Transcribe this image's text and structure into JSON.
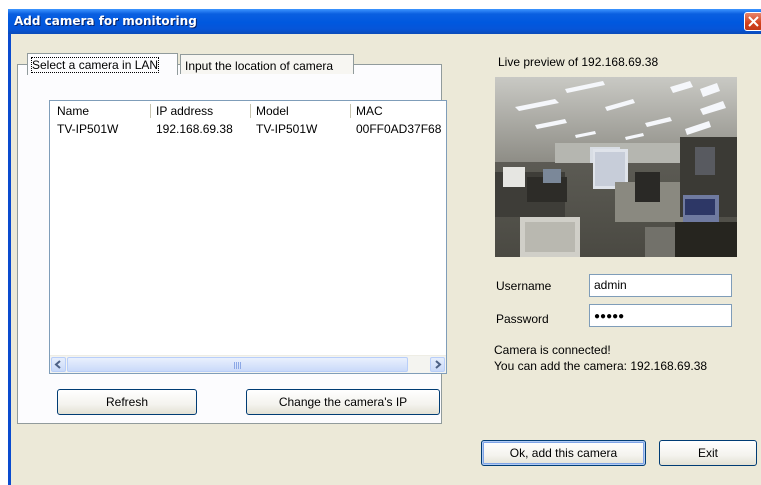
{
  "window": {
    "title": "Add camera for monitoring"
  },
  "tabs": [
    {
      "label": "Select a camera in LAN",
      "active": true
    },
    {
      "label": "Input the location of camera",
      "active": false
    }
  ],
  "camera_list": {
    "columns": [
      "Name",
      "IP address",
      "Model",
      "MAC"
    ],
    "rows": [
      [
        "TV-IP501W",
        "192.168.69.38",
        "TV-IP501W",
        "00FF0AD37F68"
      ]
    ]
  },
  "buttons": {
    "refresh": "Refresh",
    "change_ip": "Change the camera's IP",
    "ok_add": "Ok, add this camera",
    "exit": "Exit"
  },
  "preview": {
    "label": "Live preview of 192.168.69.38"
  },
  "credentials": {
    "username_label": "Username",
    "username_value": "admin",
    "password_label": "Password",
    "password_value": "●●●●●"
  },
  "status": {
    "line1": "Camera is connected!",
    "line2": "You can add the camera: 192.168.69.38"
  },
  "colors": {
    "titlebar": "#0058DF",
    "dialog_face": "#ECE9D8",
    "close_button": "#D3411C",
    "field_border": "#7F9DB9"
  }
}
